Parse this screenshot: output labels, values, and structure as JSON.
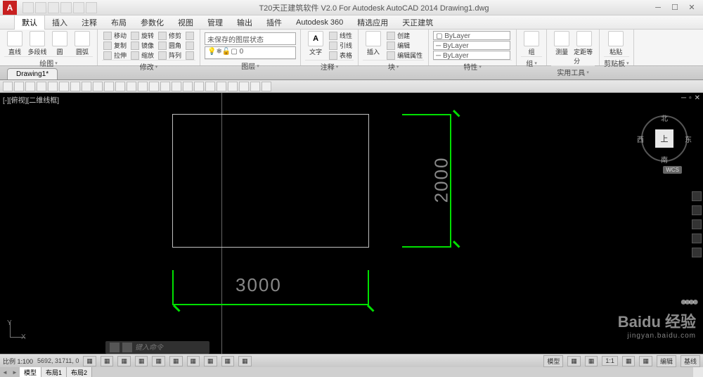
{
  "title": "T20天正建筑软件 V2.0 For Autodesk AutoCAD 2014   Drawing1.dwg",
  "logo_letter": "A",
  "menu": [
    "默认",
    "插入",
    "注释",
    "布局",
    "参数化",
    "视图",
    "管理",
    "输出",
    "插件",
    "Autodesk 360",
    "精选应用",
    "天正建筑"
  ],
  "active_menu": 0,
  "panels": {
    "draw": {
      "label": "绘图",
      "big": [
        {
          "t": "直线"
        },
        {
          "t": "多段线"
        },
        {
          "t": "圆"
        },
        {
          "t": "圆弧"
        }
      ]
    },
    "modify": {
      "label": "修改",
      "items": [
        "移动",
        "旋转",
        "修剪",
        "复制",
        "镜像",
        "圆角",
        "拉伸",
        "缩放",
        "阵列"
      ]
    },
    "layer": {
      "label": "图层",
      "combo": "未保存的图层状态",
      "combo2": "0"
    },
    "annot": {
      "label": "注释",
      "big": [
        {
          "t": "文字"
        }
      ],
      "items": [
        "线性",
        "引线",
        "表格"
      ]
    },
    "block": {
      "label": "块",
      "big": [
        {
          "t": "插入"
        }
      ],
      "items": [
        "创建",
        "编辑",
        "编辑属性"
      ]
    },
    "props": {
      "label": "特性",
      "combo": "ByLayer",
      "combo2": "ByLayer",
      "combo3": "ByLayer"
    },
    "group": {
      "label": "组",
      "big": [
        {
          "t": "组"
        }
      ]
    },
    "util": {
      "label": "实用工具",
      "big": [
        {
          "t": "测量"
        },
        {
          "t": "定距等分"
        }
      ]
    },
    "clip": {
      "label": "剪贴板",
      "big": [
        {
          "t": "粘贴"
        }
      ]
    }
  },
  "file_tab": "Drawing1*",
  "view_label": "[-][俯视][二维线框]",
  "viewcube": {
    "face": "上",
    "n": "北",
    "s": "南",
    "e": "东",
    "w": "西",
    "wcs": "WCS"
  },
  "dims": {
    "h": "3000",
    "v": "2000"
  },
  "ucs": {
    "x": "X",
    "y": "Y"
  },
  "cmd_placeholder": "键入命令",
  "layouts": [
    "模型",
    "布局1",
    "布局2"
  ],
  "active_layout": 0,
  "status": {
    "scale": "比例 1:100",
    "coords": "5692, 31711, 0",
    "right": [
      "模型",
      "1:1",
      "编辑",
      "基线"
    ]
  },
  "watermark": {
    "brand": "Baidu 经验",
    "url": "jingyan.baidu.com"
  }
}
